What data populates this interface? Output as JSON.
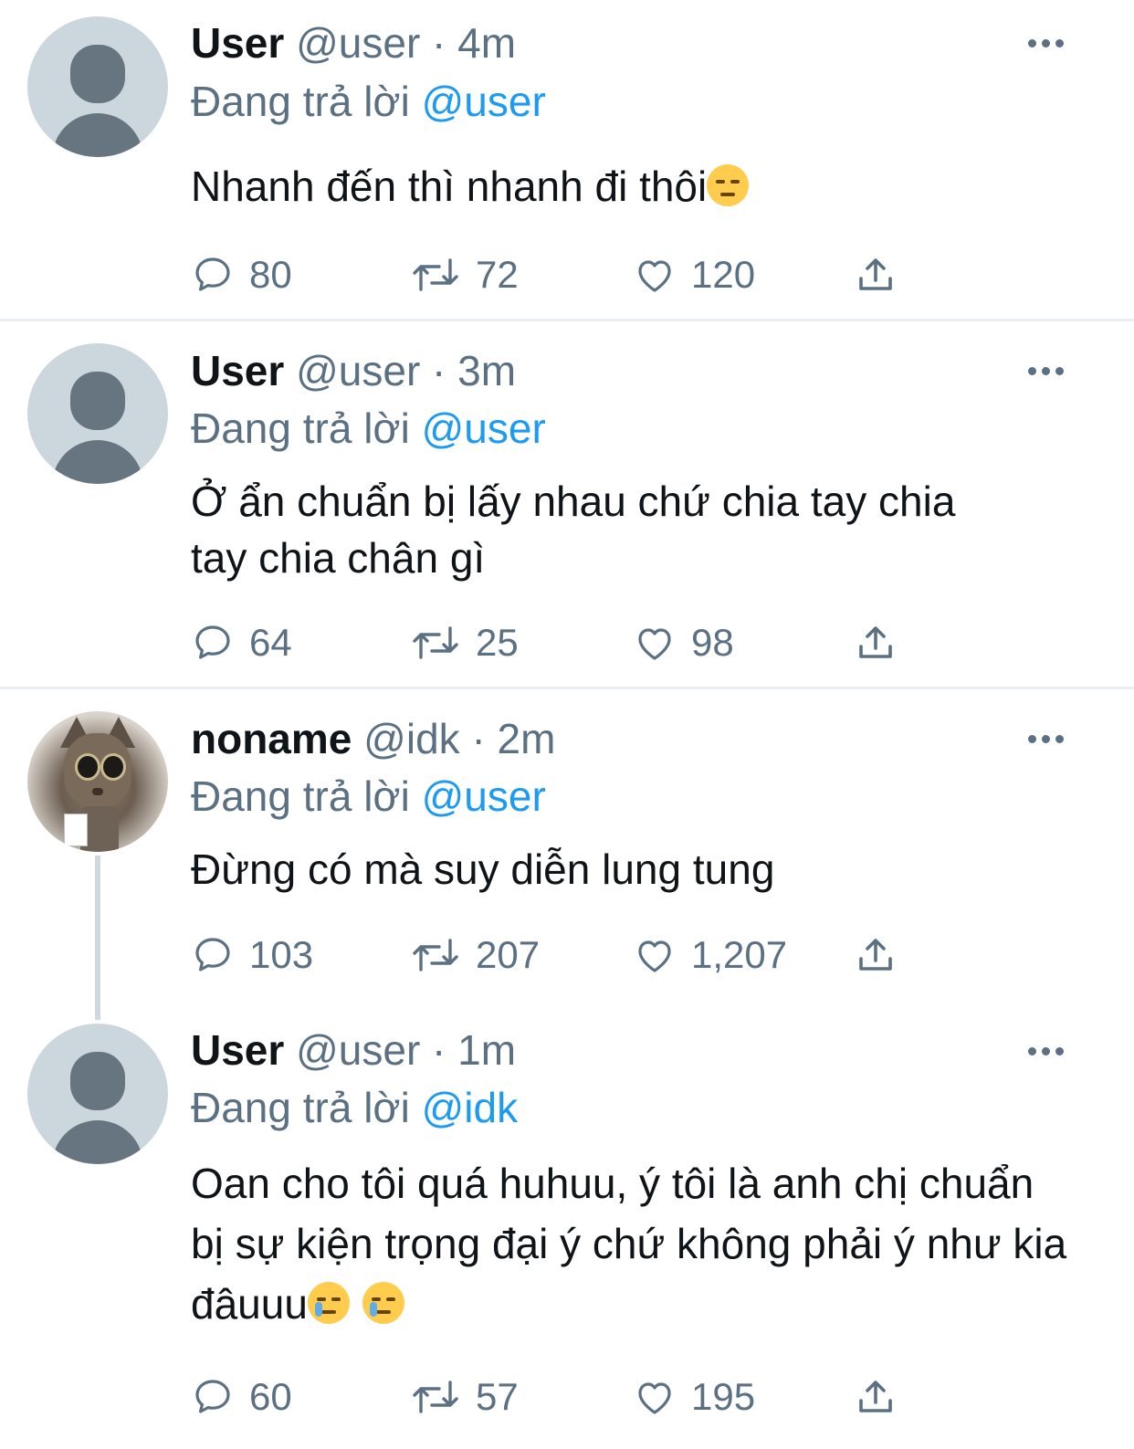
{
  "tweets": [
    {
      "name": "User",
      "handle": "@user",
      "time": "4m",
      "reply_prefix": "Đang trả lời",
      "reply_to": "@user",
      "text": "Nhanh đến thì nhanh đi thôi",
      "emojis": [
        "relieved-face"
      ],
      "replies": "80",
      "retweets": "72",
      "likes": "120"
    },
    {
      "name": "User",
      "handle": "@user",
      "time": "3m",
      "reply_prefix": "Đang trả lời",
      "reply_to": "@user",
      "text": "Ở ẩn chuẩn bị lấy nhau chứ chia tay chia tay chia chân gì",
      "replies": "64",
      "retweets": "25",
      "likes": "98"
    },
    {
      "name": "noname",
      "handle": "@idk",
      "time": "2m",
      "reply_prefix": "Đang trả lời",
      "reply_to": "@user",
      "text": "Đừng có mà suy diễn lung tung",
      "replies": "103",
      "retweets": "207",
      "likes": "1,207"
    },
    {
      "name": "User",
      "handle": "@user",
      "time": "1m",
      "reply_prefix": "Đang trả lời",
      "reply_to": "@idk",
      "text": "Oan cho tôi quá huhuu, ý tôi là anh chị chuẩn bị sự kiện trọng đại ý chứ không phải ý như kia đâuuu",
      "emojis": [
        "crying-face",
        "crying-face"
      ],
      "replies": "60",
      "retweets": "57",
      "likes": "195"
    }
  ],
  "separator": "·",
  "icons": [
    "reply-icon",
    "retweet-icon",
    "like-icon",
    "share-icon",
    "more-options-icon"
  ],
  "colors": {
    "link": "#1d9bf0",
    "secondary": "#5b7083",
    "text": "#0f1419",
    "avatar_bg": "#ccd6dd"
  }
}
